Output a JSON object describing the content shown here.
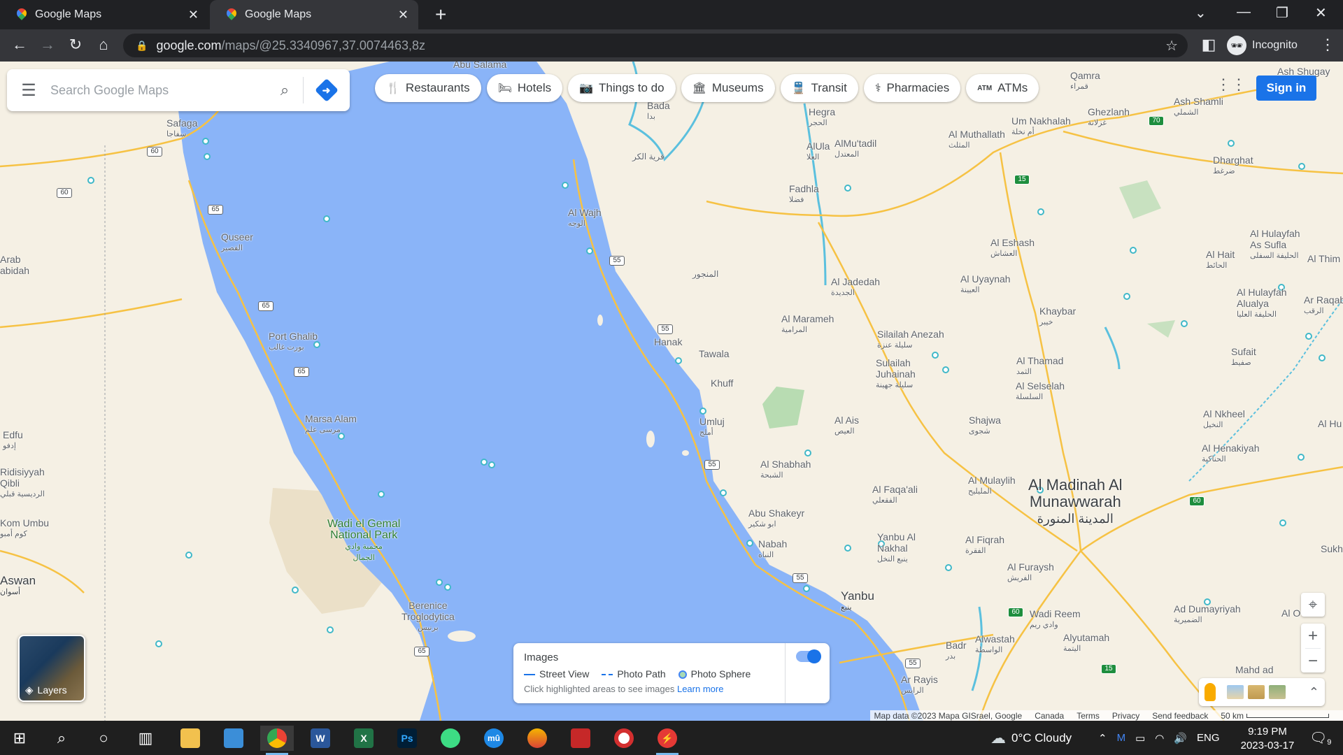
{
  "browser": {
    "tabs": [
      {
        "title": "Google Maps"
      },
      {
        "title": "Google Maps"
      }
    ],
    "url_host": "google.com",
    "url_path": "/maps/@25.3340967,37.0074463,8z",
    "profile_label": "Incognito"
  },
  "search": {
    "placeholder": "Search Google Maps"
  },
  "chips": [
    {
      "label": "Restaurants",
      "icon": "restaurant-icon"
    },
    {
      "label": "Hotels",
      "icon": "hotel-icon"
    },
    {
      "label": "Things to do",
      "icon": "camera-icon"
    },
    {
      "label": "Museums",
      "icon": "museum-icon"
    },
    {
      "label": "Transit",
      "icon": "transit-icon"
    },
    {
      "label": "Pharmacies",
      "icon": "pharmacy-icon"
    },
    {
      "label": "ATMs",
      "icon": "atm-icon"
    }
  ],
  "sign_in_label": "Sign in",
  "layers_label": "Layers",
  "images_panel": {
    "title": "Images",
    "street_view": "Street View",
    "photo_path": "Photo Path",
    "photo_sphere": "Photo Sphere",
    "hint": "Click highlighted areas to see images",
    "learn_more": "Learn more",
    "toggle_on": true
  },
  "map_labels": {
    "abu_salama": "Abu Salama",
    "safaga": {
      "en": "Safaga",
      "ar": "سفاجا"
    },
    "quseer": {
      "en": "Quseer",
      "ar": "القصير"
    },
    "arab_abidah": "Arab\nabidah",
    "port_ghalib": {
      "en": "Port Ghalib",
      "ar": "بورت غالب"
    },
    "marsa_alam": {
      "en": "Marsa Alam",
      "ar": "مرسى علم"
    },
    "edfu": {
      "en": "Edfu",
      "ar": "إدفو"
    },
    "ridisiyyah": {
      "en": "Ridisiyyah\nQibli",
      "ar": "الرديسية قبلي"
    },
    "kom_umbu": {
      "en": "Kom Umbu",
      "ar": "كوم أمبو"
    },
    "aswan": {
      "en": "Aswan",
      "ar": "أسوان"
    },
    "wadi_el_gemal": {
      "en": "Wadi el Gemal\nNational Park",
      "ar": "محمية وادي\nالجمال"
    },
    "berenice": {
      "en": "Berenice\nTroglodytica",
      "ar": "برنيس"
    },
    "al_wajh": {
      "en": "Al Wajh",
      "ar": "الوجه"
    },
    "qaryat_al_karr": "قرية الكر",
    "baqa": {
      "en": "Bada",
      "ar": "بدا"
    },
    "hanak": "Hanak",
    "tawala": "Tawala",
    "khuff": "Khuff",
    "umluj": {
      "en": "Umluj",
      "ar": "أملج"
    },
    "al_shabhah": {
      "en": "Al Shabhah",
      "ar": "الشبحة"
    },
    "abu_shakeyr": {
      "en": "Abu Shakeyr",
      "ar": "ابو شكير"
    },
    "nabah": {
      "en": "Nabah",
      "ar": "النباه"
    },
    "yanbu": {
      "en": "Yanbu",
      "ar": "ينبع"
    },
    "al_manjur": "المنجور",
    "hegra": {
      "en": "Hegra",
      "ar": "الحجر"
    },
    "alula": {
      "en": "AlUla",
      "ar": "العلا"
    },
    "almutadil": {
      "en": "AlMu'tadil",
      "ar": "المعتدل"
    },
    "fadhla": {
      "en": "Fadhla",
      "ar": "فضلا"
    },
    "al_jadedah": {
      "en": "Al Jadedah",
      "ar": "الجديدة"
    },
    "al_marameh": {
      "en": "Al Marameh",
      "ar": "المرامية"
    },
    "silailah_anezah": {
      "en": "Silailah Anezah",
      "ar": "سليلة عنزة"
    },
    "sulailah_juhainah": {
      "en": "Sulailah\nJuhainah",
      "ar": "سليلة جهينة"
    },
    "al_ais": {
      "en": "Al Ais",
      "ar": "العيص"
    },
    "al_faqaali": {
      "en": "Al Faqa'ali",
      "ar": "الفقعلي"
    },
    "yanbu_al_nakhl": {
      "en": "Yanbu Al\nNakhal",
      "ar": "ينبع النخل"
    },
    "badr": {
      "en": "Badr",
      "ar": "بدر"
    },
    "alwastah": {
      "en": "Alwastah",
      "ar": "الواسطة"
    },
    "al_eshash": {
      "en": "Al Eshash",
      "ar": "العشاش"
    },
    "al_uyaynah": {
      "en": "Al Uyaynah",
      "ar": "العيينة"
    },
    "khaybar": {
      "en": "Khaybar",
      "ar": "خيبر"
    },
    "al_thamad": {
      "en": "Al Thamad",
      "ar": "الثمد"
    },
    "al_selselah": {
      "en": "Al Selselah",
      "ar": "السلسلة"
    },
    "shajwa": {
      "en": "Shajwa",
      "ar": "شجوى"
    },
    "al_mulaylih": {
      "en": "Al Mulaylih",
      "ar": "المليليح"
    },
    "al_fuqrah": {
      "en": "Al Fiqrah",
      "ar": "الفقرة"
    },
    "al_furaysh": {
      "en": "Al Furaysh",
      "ar": "الفريش"
    },
    "wadi_reem": {
      "en": "Wadi Reem",
      "ar": "وادي ريم"
    },
    "alyutamah": {
      "en": "Alyutamah",
      "ar": "اليتمة"
    },
    "madinah": {
      "en": "Al Madinah Al\nMunawwarah",
      "ar": "المدينة المنورة"
    },
    "um_nakhalah": {
      "en": "Um Nakhalah",
      "ar": "أم نخلة"
    },
    "al_muthallath": {
      "en": "Al Muthallath",
      "ar": "المثلث"
    },
    "ghezlanh": {
      "en": "Ghezlanh",
      "ar": "غزلانة"
    },
    "qamra": {
      "en": "Qamra",
      "ar": "قمراء"
    },
    "ash_shamli": {
      "en": "Ash Shamli",
      "ar": "الشملي"
    },
    "ash_shugay": "Ash Shugay",
    "dharghat": {
      "en": "Dharghat",
      "ar": "ضرغط"
    },
    "al_hulayfah_as_sufla": {
      "en": "Al Hulayfah\nAs Sufla",
      "ar": "الحليفة السفلى"
    },
    "al_hait": {
      "en": "Al Hait",
      "ar": "الحائط"
    },
    "al_thim": "Al Thim",
    "al_hulayfah_alualya": {
      "en": "Al Hulayfah\nAlualya",
      "ar": "الحليفة العليا"
    },
    "ar_raqab": {
      "en": "Ar Raqab",
      "ar": "الرقب"
    },
    "sufait": {
      "en": "Sufait",
      "ar": "صفيط"
    },
    "al_nkheel": {
      "en": "Al Nkheel",
      "ar": "النخيل"
    },
    "al_henakiyah": {
      "en": "Al Henakiyah",
      "ar": "الحناكية"
    },
    "al_hu": "Al Hu",
    "sukh": "Sukh",
    "ad_dumayriyah": {
      "en": "Ad Dumayriyah",
      "ar": "الضميرية"
    },
    "al_o": "Al O",
    "mahd_ad": "Mahd ad",
    "ar_rayis": {
      "en": "Ar Rayis",
      "ar": "الرايس"
    }
  },
  "road_shields": [
    "60",
    "60",
    "65",
    "65",
    "65",
    "65",
    "55",
    "55",
    "55",
    "55",
    "55",
    "15",
    "70",
    "60",
    "60",
    "15"
  ],
  "attribution": {
    "map_data": "Map data ©2023 Mapa GISrael, Google",
    "country": "Canada",
    "terms": "Terms",
    "privacy": "Privacy",
    "feedback": "Send feedback",
    "scale": "50 km"
  },
  "taskbar": {
    "weather": "0°C  Cloudy",
    "language": "ENG",
    "time": "9:19 PM",
    "date": "2023-03-17",
    "notifications": "9",
    "apps": [
      {
        "name": "file-explorer",
        "label": ""
      },
      {
        "name": "control-panel",
        "label": ""
      },
      {
        "name": "chrome",
        "label": ""
      },
      {
        "name": "word",
        "label": "W"
      },
      {
        "name": "excel",
        "label": "X"
      },
      {
        "name": "photoshop",
        "label": "Ps"
      },
      {
        "name": "android-app",
        "label": ""
      },
      {
        "name": "mu-app",
        "label": "mû"
      },
      {
        "name": "media-app",
        "label": ""
      },
      {
        "name": "record-app",
        "label": ""
      },
      {
        "name": "disc-app",
        "label": ""
      },
      {
        "name": "bolt-app",
        "label": ""
      }
    ]
  },
  "colors": {
    "sea": "#8ab4f8",
    "land": "#f5f0e4",
    "road": "#f6c244",
    "accent": "#1a73e8",
    "park": "#a8dab5"
  }
}
